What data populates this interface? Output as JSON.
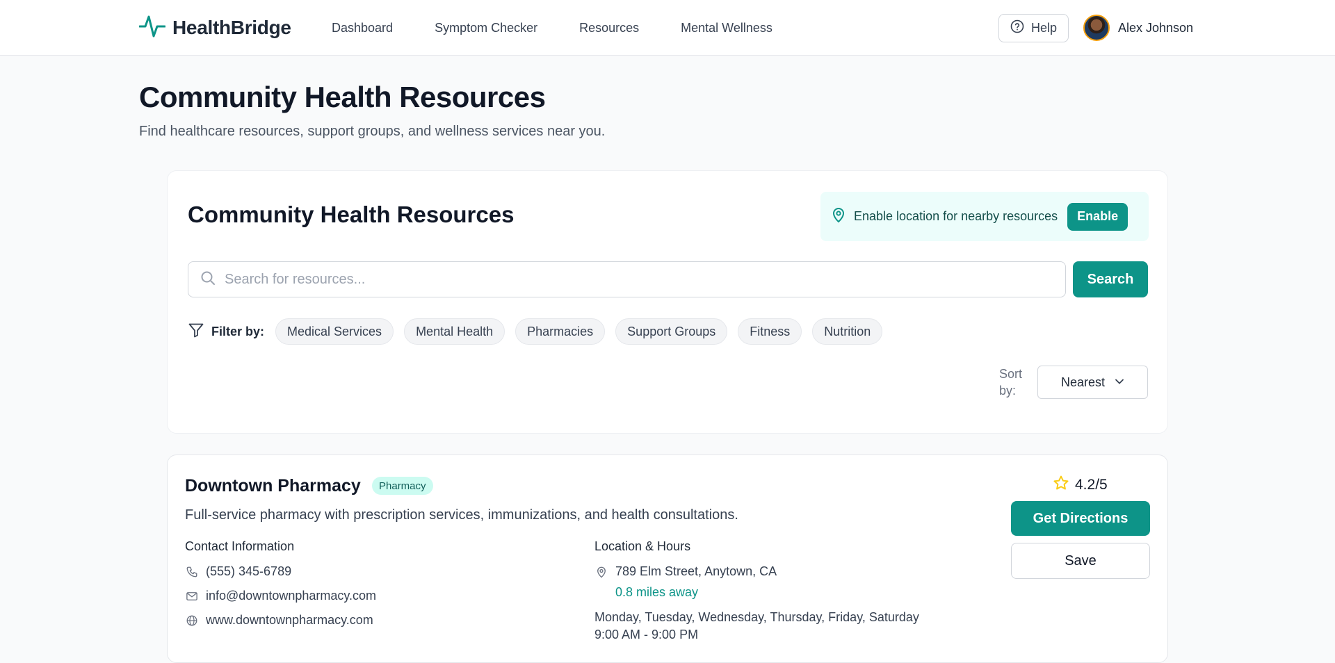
{
  "app": {
    "name": "HealthBridge"
  },
  "nav": [
    {
      "label": "Dashboard"
    },
    {
      "label": "Symptom Checker"
    },
    {
      "label": "Resources"
    },
    {
      "label": "Mental Wellness"
    }
  ],
  "header": {
    "help_label": "Help",
    "user_name": "Alex Johnson"
  },
  "page": {
    "title": "Community Health Resources",
    "subtitle": "Find healthcare resources, support groups, and wellness services near you."
  },
  "search_card": {
    "title": "Community Health Resources",
    "location_prompt": "Enable location for nearby resources",
    "enable_label": "Enable",
    "search_placeholder": "Search for resources...",
    "search_value": "",
    "search_button": "Search",
    "filter_label": "Filter by:",
    "filters": [
      "Medical Services",
      "Mental Health",
      "Pharmacies",
      "Support Groups",
      "Fitness",
      "Nutrition"
    ],
    "sort_label": "Sort by:",
    "sort_value": "Nearest"
  },
  "resource": {
    "name": "Downtown Pharmacy",
    "badge": "Pharmacy",
    "description": "Full-service pharmacy with prescription services, immunizations, and health consultations.",
    "contact_title": "Contact Information",
    "phone": "(555) 345-6789",
    "email": "info@downtownpharmacy.com",
    "website": "www.downtownpharmacy.com",
    "location_title": "Location & Hours",
    "address": "789 Elm Street, Anytown, CA",
    "distance": "0.8 miles away",
    "days": "Monday, Tuesday, Wednesday, Thursday, Friday, Saturday",
    "hours": "9:00 AM - 9:00 PM",
    "rating": "4.2/5",
    "directions_label": "Get Directions",
    "save_label": "Save"
  },
  "colors": {
    "accent": "#0d9488",
    "accent_light": "#ecfdfb",
    "badge_bg": "#ccfbf1",
    "star": "#facc15"
  },
  "icons": [
    "pulse-logo-icon",
    "help-circle-icon",
    "map-pin-icon",
    "search-icon",
    "filter-icon",
    "chevron-down-icon",
    "star-icon",
    "phone-icon",
    "mail-icon",
    "globe-icon"
  ]
}
